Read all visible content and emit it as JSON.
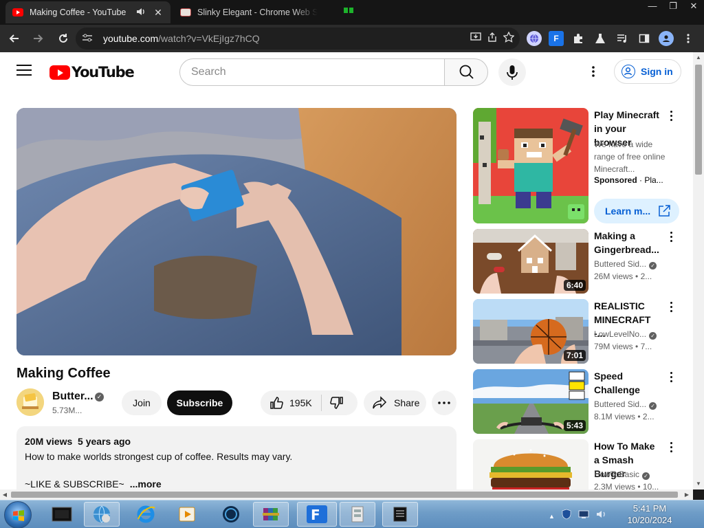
{
  "browser": {
    "tabs": [
      {
        "title": "Making Coffee - YouTube",
        "active": true,
        "audio": true
      },
      {
        "title": "Slinky Elegant - Chrome Web Store",
        "active": false
      }
    ],
    "url_host": "youtube.com",
    "url_path": "/watch?v=VkEjIgz7hCQ",
    "controls": {
      "minimize": "—",
      "restore": "❐",
      "close": "✕"
    }
  },
  "youtube": {
    "logo_text": "YouTube",
    "search_placeholder": "Search",
    "sign_in_label": "Sign in",
    "brand_color": "#ff0000",
    "link_color": "#065fd4"
  },
  "video": {
    "title": "Making Coffee",
    "channel_name": "Butter...",
    "subscribers": "5.73M...",
    "join_label": "Join",
    "subscribe_label": "Subscribe",
    "likes": "195K",
    "share_label": "Share",
    "description": {
      "views": "20M views",
      "age": "5 years ago",
      "line1": "How to make worlds strongest cup of coffee. Results may vary.",
      "line2": "~LIKE & SUBSCRIBE~",
      "more_label": "...more"
    }
  },
  "sidebar": {
    "ad": {
      "title": "Play Minecraft in your browser",
      "description": "We have a wide range of free online Minecraft...",
      "sponsored_label": "Sponsored",
      "advertiser": "Pla...",
      "cta_label": "Learn m..."
    },
    "videos": [
      {
        "title": "Making a Gingerbread...",
        "channel": "Buttered Sid...",
        "views": "26M views",
        "age": "2...",
        "duration": "6:40"
      },
      {
        "title": "REALISTIC MINECRAFT -...",
        "channel": "LowLevelNo...",
        "views": "79M views",
        "age": "7...",
        "duration": "7:01"
      },
      {
        "title": "Speed Challenge",
        "channel": "Buttered Sid...",
        "views": "8.1M views",
        "age": "2...",
        "duration": "5:43"
      },
      {
        "title": "How To Make a Smash Burger",
        "channel": "HowToBasic",
        "views": "2.3M views",
        "age": "10...",
        "duration": ""
      }
    ]
  },
  "taskbar": {
    "time": "5:41 PM",
    "date": "10/20/2024"
  }
}
